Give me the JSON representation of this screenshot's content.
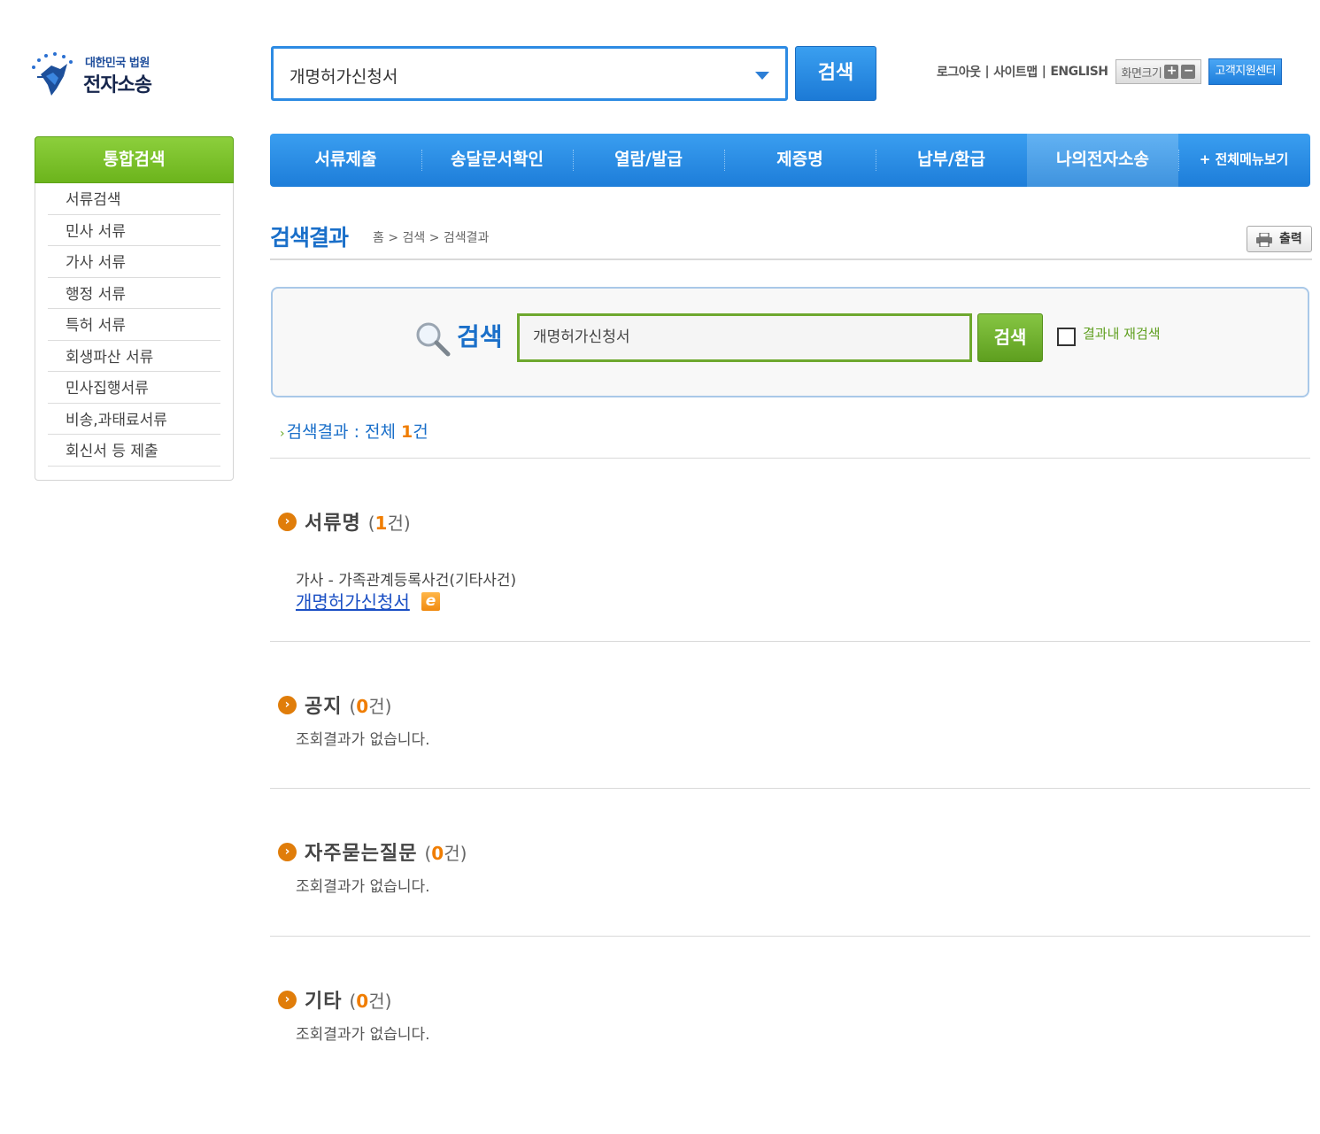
{
  "header": {
    "logo_sub": "대한민국 법원",
    "logo_main": "전자소송",
    "search_value": "개명허가신청서",
    "search_button": "검색",
    "util_links": [
      "로그아웃",
      "사이트맵",
      "ENGLISH"
    ],
    "zoom_label": "화면크기",
    "zoom_in": "+",
    "zoom_out": "−",
    "support": "고객지원센터"
  },
  "sidebar": {
    "title": "통합검색",
    "items": [
      {
        "label": "서류검색"
      },
      {
        "label": "민사 서류"
      },
      {
        "label": "가사 서류"
      },
      {
        "label": "행정 서류"
      },
      {
        "label": "특허 서류"
      },
      {
        "label": "회생파산 서류"
      },
      {
        "label": "민사집행서류"
      },
      {
        "label": "비송,과태료서류"
      },
      {
        "label": "회신서 등 제출"
      }
    ]
  },
  "nav": {
    "items": [
      {
        "label": "서류제출"
      },
      {
        "label": "송달문서확인"
      },
      {
        "label": "열람/발급"
      },
      {
        "label": "제증명"
      },
      {
        "label": "납부/환급"
      },
      {
        "label": "나의전자소송"
      }
    ],
    "all_menu": "+ 전체메뉴보기"
  },
  "page": {
    "title": "검색결과",
    "breadcrumb": "홈 > 검색 > 검색결과",
    "print": "출력"
  },
  "search": {
    "label": "검색",
    "value": "개명허가신청서",
    "button": "검색",
    "research_label": "결과내 재검색",
    "research_checked": false
  },
  "summary": {
    "prefix": "검색결과 : 전체 ",
    "count": "1",
    "suffix": "건"
  },
  "sections": [
    {
      "title": "서류명",
      "count": "1"
    },
    {
      "title": "공지",
      "count": "0",
      "empty": "조회결과가 없습니다."
    },
    {
      "title": "자주묻는질문",
      "count": "0",
      "empty": "조회결과가 없습니다."
    },
    {
      "title": "기타",
      "count": "0",
      "empty": "조회결과가 없습니다."
    }
  ],
  "documents": [
    {
      "category": "가사 - 가족관계등록사건(기타사건)",
      "name": "개명허가신청서",
      "badge": "e"
    }
  ],
  "colors": {
    "primary_blue": "#1d7dd9",
    "green": "#6cb41c",
    "orange": "#f07d00"
  },
  "count_open": "(",
  "count_close": "건)"
}
